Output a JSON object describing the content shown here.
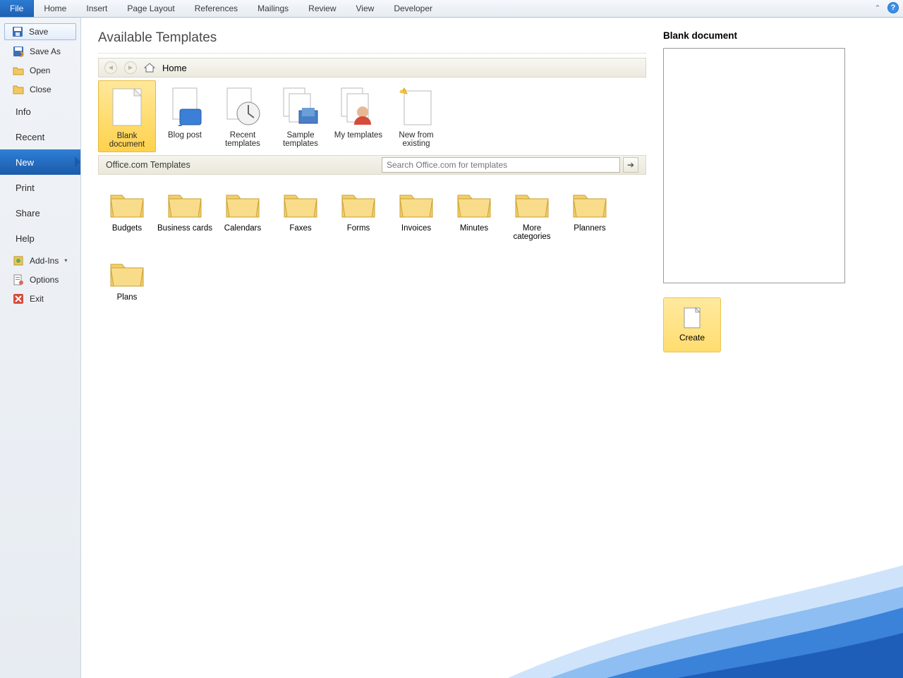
{
  "ribbon": {
    "tabs": [
      "File",
      "Home",
      "Insert",
      "Page Layout",
      "References",
      "Mailings",
      "Review",
      "View",
      "Developer"
    ]
  },
  "sidebar": {
    "save": "Save",
    "saveas": "Save As",
    "open": "Open",
    "close": "Close",
    "info": "Info",
    "recent": "Recent",
    "new": "New",
    "print": "Print",
    "share": "Share",
    "help": "Help",
    "addins": "Add-Ins",
    "options": "Options",
    "exit": "Exit"
  },
  "main": {
    "heading": "Available Templates",
    "breadcrumb_home": "Home",
    "tiles": [
      {
        "label": "Blank document"
      },
      {
        "label": "Blog post"
      },
      {
        "label": "Recent templates"
      },
      {
        "label": "Sample templates"
      },
      {
        "label": "My templates"
      },
      {
        "label": "New from existing"
      }
    ],
    "section_label": "Office.com Templates",
    "search_placeholder": "Search Office.com for templates",
    "folders": [
      "Budgets",
      "Business cards",
      "Calendars",
      "Faxes",
      "Forms",
      "Invoices",
      "Minutes",
      "More categories",
      "Planners",
      "Plans"
    ]
  },
  "preview": {
    "title": "Blank document",
    "create": "Create"
  }
}
